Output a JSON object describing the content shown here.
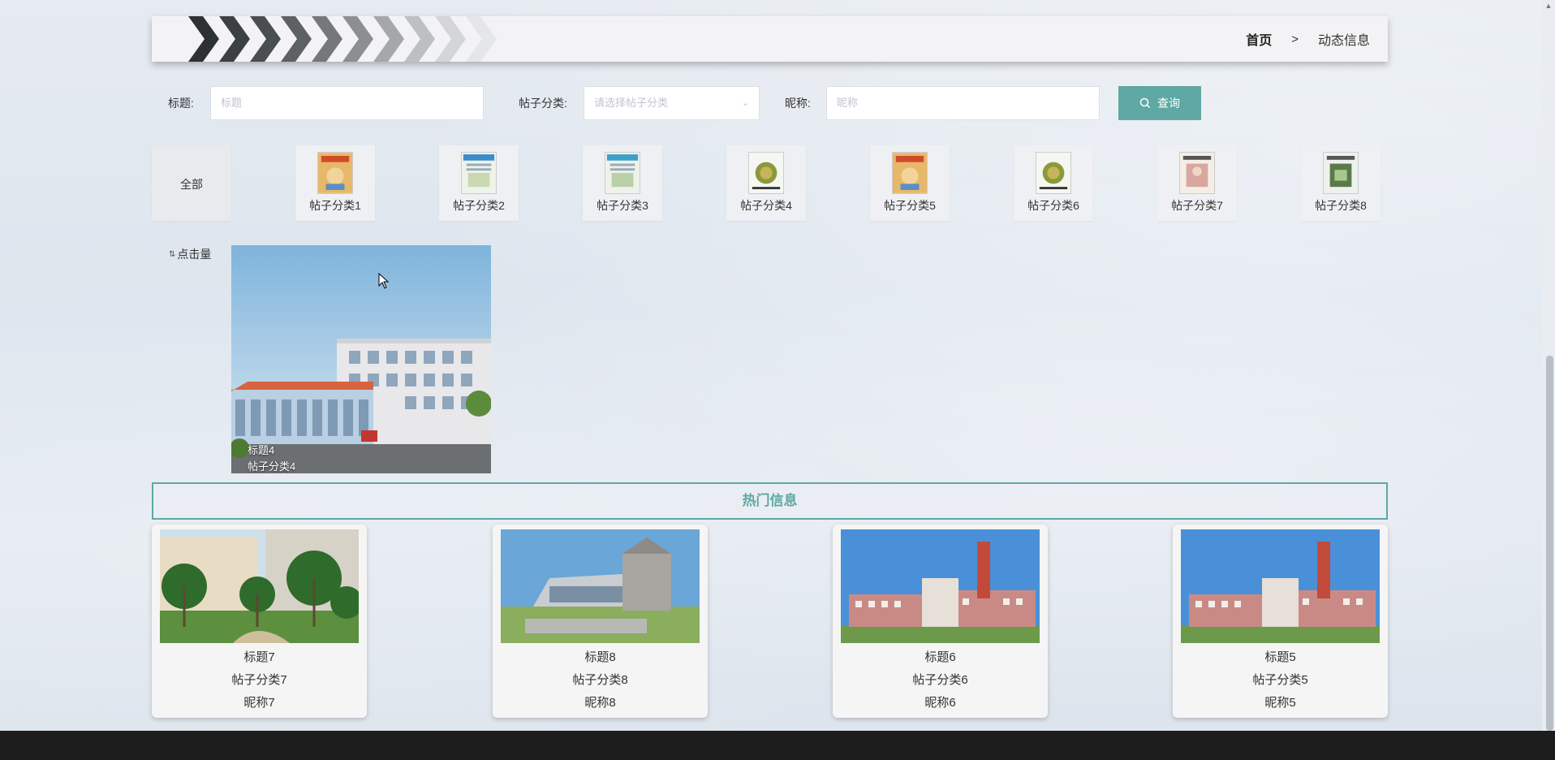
{
  "breadcrumb": {
    "home": "首页",
    "separator": ">",
    "current": "动态信息"
  },
  "search": {
    "title_label": "标题:",
    "title_placeholder": "标题",
    "category_label": "帖子分类:",
    "category_placeholder": "请选择帖子分类",
    "nickname_label": "昵称:",
    "nickname_placeholder": "昵称",
    "button_label": "查询",
    "button_color": "#5fa8a3"
  },
  "categories": [
    "全部",
    "帖子分类1",
    "帖子分类2",
    "帖子分类3",
    "帖子分类4",
    "帖子分类5",
    "帖子分类6",
    "帖子分类7",
    "帖子分类8"
  ],
  "sort": {
    "label": "点击量"
  },
  "posts": [
    {
      "title": "标题4",
      "category": "帖子分类4"
    }
  ],
  "hot": {
    "title": "热门信息",
    "items": [
      {
        "title": "标题7",
        "category": "帖子分类7",
        "nickname": "昵称7"
      },
      {
        "title": "标题8",
        "category": "帖子分类8",
        "nickname": "昵称8"
      },
      {
        "title": "标题6",
        "category": "帖子分类6",
        "nickname": "昵称6"
      },
      {
        "title": "标题5",
        "category": "帖子分类5",
        "nickname": "昵称5"
      }
    ]
  },
  "colors": {
    "accent": "#5fa8a3"
  }
}
